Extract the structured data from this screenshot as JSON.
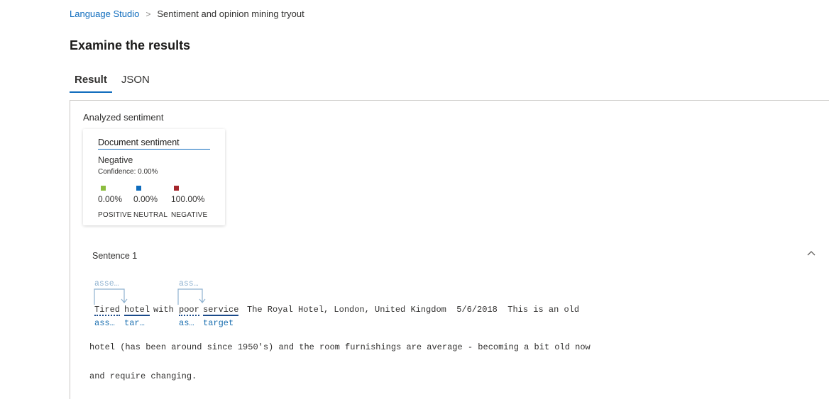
{
  "breadcrumb": {
    "root": "Language Studio",
    "current": "Sentiment and opinion mining tryout"
  },
  "page_title": "Examine the results",
  "tabs": [
    {
      "label": "Result",
      "active": true
    },
    {
      "label": "JSON",
      "active": false
    }
  ],
  "analyzed": {
    "section_label": "Analyzed sentiment",
    "card": {
      "title": "Document sentiment",
      "sentiment": "Negative",
      "confidence": "Confidence: 0.00%",
      "scores": [
        {
          "value": "0.00%",
          "label": "POSITIVE",
          "color": "#8cbd3f"
        },
        {
          "value": "0.00%",
          "label": "NEUTRAL",
          "color": "#0f6cbd"
        },
        {
          "value": "100.00%",
          "label": "NEGATIVE",
          "color": "#a4262c"
        }
      ]
    }
  },
  "sentence": {
    "heading": "Sentence 1",
    "annotations_top": [
      "asse…",
      "ass…"
    ],
    "words": {
      "w1": "Tired",
      "w2": "hotel",
      "w3": "with",
      "w4": "poor",
      "w5": "service"
    },
    "line1_rest": "The Royal Hotel, London, United Kingdom  5/6/2018  This is an old",
    "annotations_bottom": [
      "ass…",
      "tar…",
      "as…",
      "target"
    ],
    "line2": "hotel (has been around since 1950's) and the room furnishings are average - becoming a bit old now",
    "line3": "and require changing."
  },
  "colors": {
    "accent": "#0f6cbd",
    "annotation_light": "#8fb2d0",
    "annotation_dark": "#1a6fb0"
  }
}
